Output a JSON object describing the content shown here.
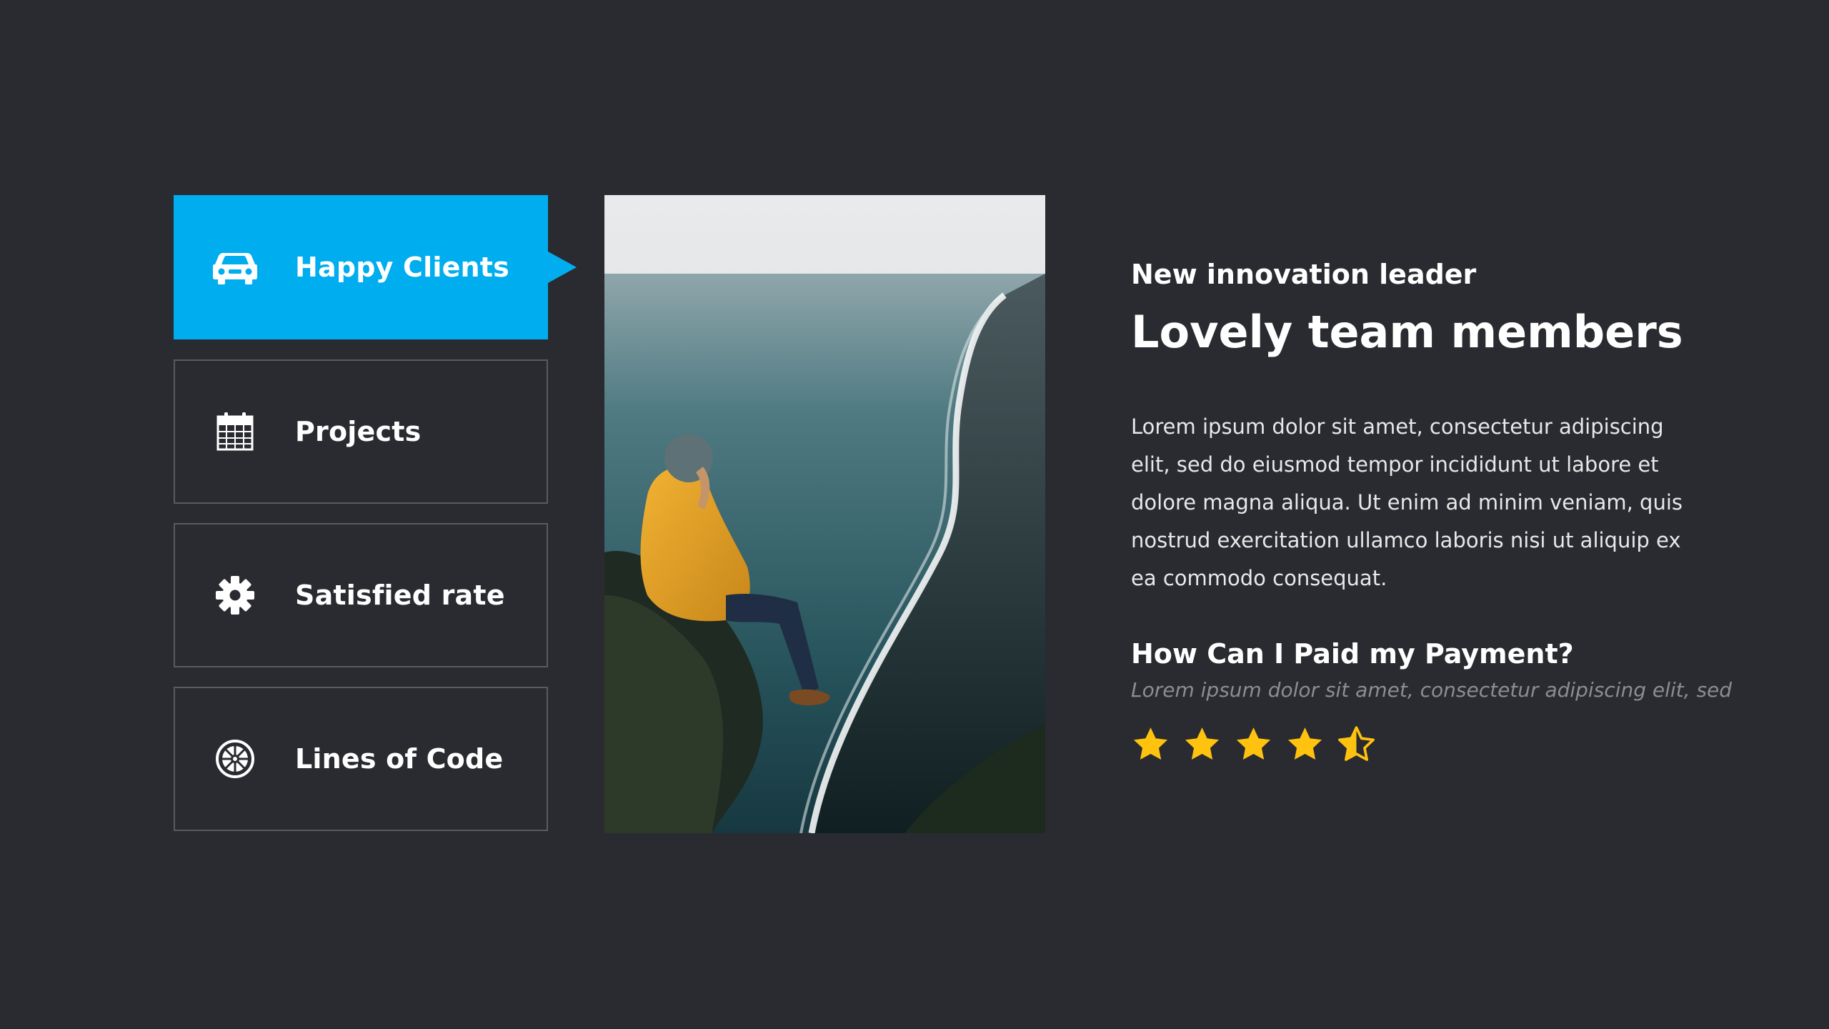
{
  "tabs": [
    {
      "label": "Happy Clients",
      "icon": "car-icon",
      "active": true
    },
    {
      "label": "Projects",
      "icon": "calendar-icon",
      "active": false
    },
    {
      "label": "Satisfied rate",
      "icon": "gear-icon",
      "active": false
    },
    {
      "label": "Lines of Code",
      "icon": "emblem-icon",
      "active": false
    }
  ],
  "content": {
    "eyebrow": "New innovation leader",
    "headline": "Lovely team members",
    "body": "Lorem ipsum dolor sit amet, consectetur adipiscing elit, sed do eiusmod tempor incididunt ut labore et dolore magna aliqua. Ut enim ad minim veniam, quis nostrud exercitation ullamco laboris nisi ut aliquip ex ea commodo consequat.",
    "question": "How Can I Paid my Payment?",
    "subtext": "Lorem ipsum dolor sit amet, consectetur adipiscing elit, sed"
  },
  "rating": {
    "value": 4.5,
    "max": 5
  },
  "colors": {
    "background": "#2a2b30",
    "accent": "#00adef",
    "star": "#ffc20e",
    "border": "#5a5b60"
  }
}
